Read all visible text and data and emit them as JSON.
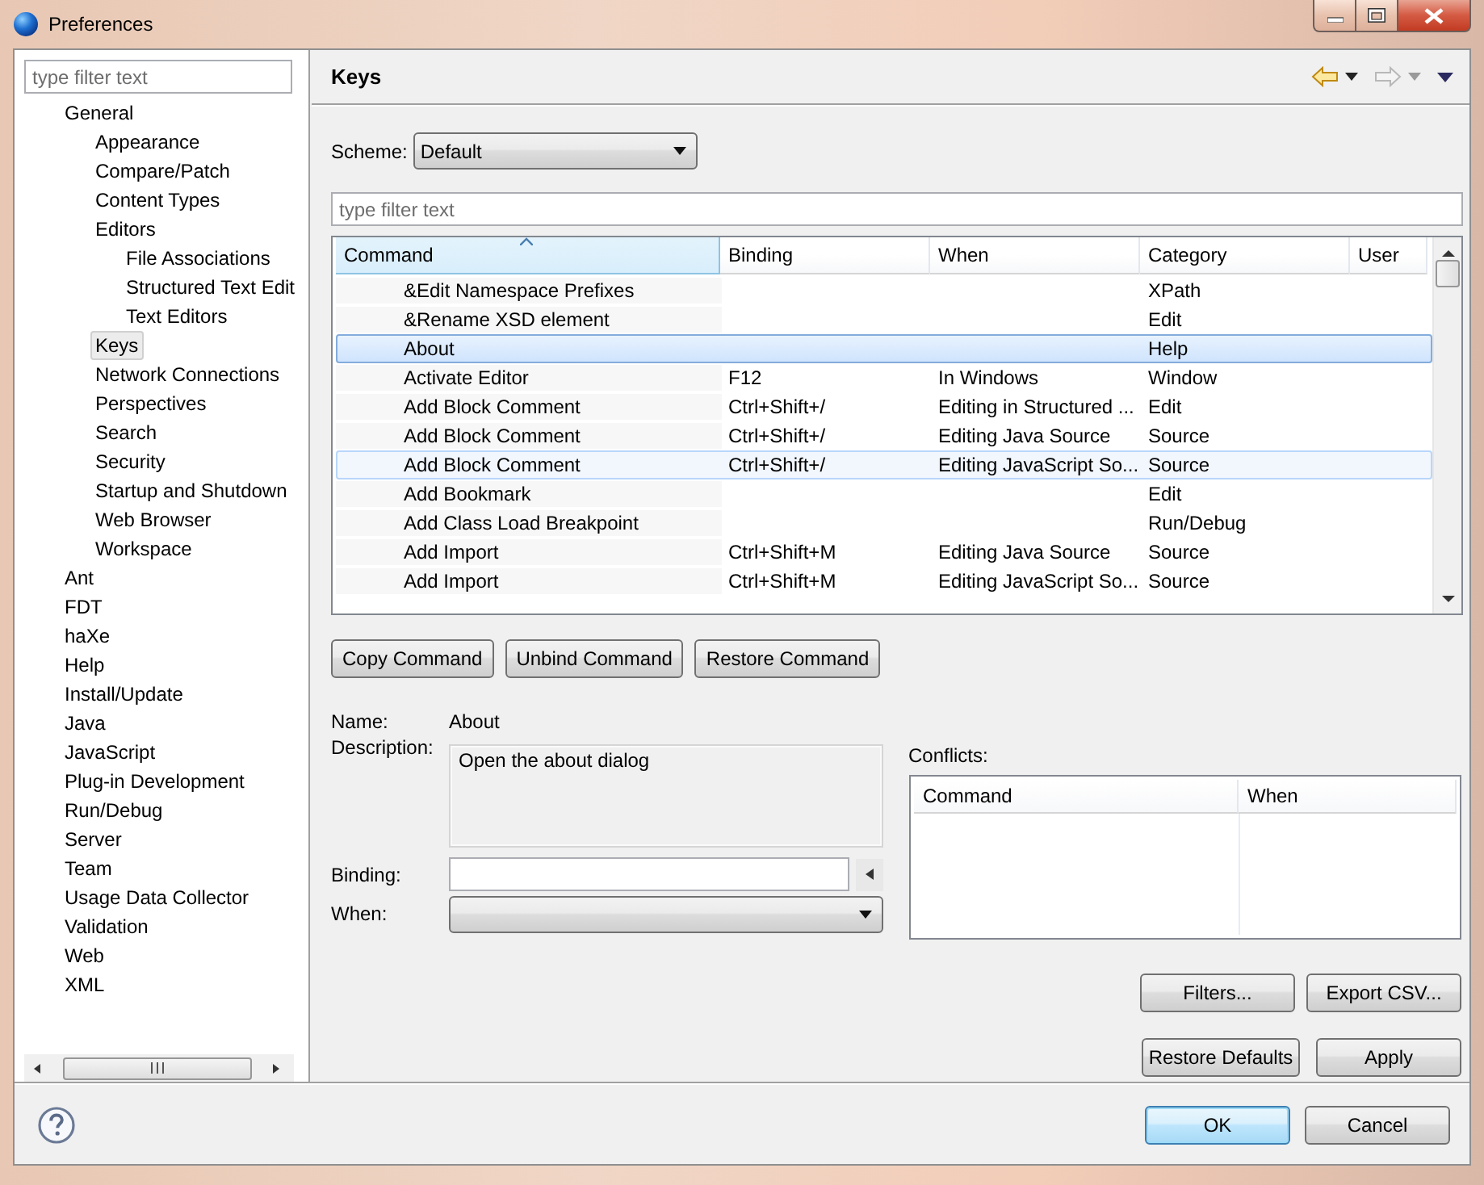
{
  "window": {
    "title": "Preferences"
  },
  "sidebar": {
    "filter": {
      "placeholder": "type filter text"
    },
    "tree": [
      {
        "label": "General",
        "selected": false,
        "children": [
          {
            "label": "Appearance",
            "selected": false
          },
          {
            "label": "Compare/Patch",
            "selected": false
          },
          {
            "label": "Content Types",
            "selected": false
          },
          {
            "label": "Editors",
            "selected": false,
            "children": [
              {
                "label": "File Associations",
                "selected": false
              },
              {
                "label": "Structured Text Edit",
                "selected": false
              },
              {
                "label": "Text Editors",
                "selected": false
              }
            ]
          },
          {
            "label": "Keys",
            "selected": true
          },
          {
            "label": "Network Connections",
            "selected": false
          },
          {
            "label": "Perspectives",
            "selected": false
          },
          {
            "label": "Search",
            "selected": false
          },
          {
            "label": "Security",
            "selected": false
          },
          {
            "label": "Startup and Shutdown",
            "selected": false
          },
          {
            "label": "Web Browser",
            "selected": false
          },
          {
            "label": "Workspace",
            "selected": false
          }
        ]
      },
      {
        "label": "Ant",
        "selected": false
      },
      {
        "label": "FDT",
        "selected": false
      },
      {
        "label": "haXe",
        "selected": false
      },
      {
        "label": "Help",
        "selected": false
      },
      {
        "label": "Install/Update",
        "selected": false
      },
      {
        "label": "Java",
        "selected": false
      },
      {
        "label": "JavaScript",
        "selected": false
      },
      {
        "label": "Plug-in Development",
        "selected": false
      },
      {
        "label": "Run/Debug",
        "selected": false
      },
      {
        "label": "Server",
        "selected": false
      },
      {
        "label": "Team",
        "selected": false
      },
      {
        "label": "Usage Data Collector",
        "selected": false
      },
      {
        "label": "Validation",
        "selected": false
      },
      {
        "label": "Web",
        "selected": false
      },
      {
        "label": "XML",
        "selected": false
      }
    ]
  },
  "page": {
    "title": "Keys",
    "scheme": {
      "label": "Scheme:",
      "value": "Default"
    },
    "filter": {
      "placeholder": "type filter text"
    },
    "table": {
      "columns": [
        {
          "label": "Command",
          "sorted": true
        },
        {
          "label": "Binding",
          "sorted": false
        },
        {
          "label": "When",
          "sorted": false
        },
        {
          "label": "Category",
          "sorted": false
        },
        {
          "label": "User",
          "sorted": false
        }
      ],
      "rows": [
        {
          "command": "&Edit Namespace Prefixes",
          "category": "XPath",
          "selected": false,
          "hovered": false
        },
        {
          "command": "&Rename XSD element",
          "category": "Edit",
          "selected": false,
          "hovered": false
        },
        {
          "command": "About",
          "category": "Help",
          "selected": true,
          "hovered": false
        },
        {
          "command": "Activate Editor",
          "binding": "F12",
          "when": "In Windows",
          "category": "Window",
          "selected": false,
          "hovered": false
        },
        {
          "command": "Add Block Comment",
          "binding": "Ctrl+Shift+/",
          "when": "Editing in Structured ...",
          "category": "Edit",
          "selected": false,
          "hovered": false
        },
        {
          "command": "Add Block Comment",
          "binding": "Ctrl+Shift+/",
          "when": "Editing Java Source",
          "category": "Source",
          "selected": false,
          "hovered": false
        },
        {
          "command": "Add Block Comment",
          "binding": "Ctrl+Shift+/",
          "when": "Editing JavaScript So...",
          "category": "Source",
          "selected": false,
          "hovered": true
        },
        {
          "command": "Add Bookmark",
          "category": "Edit",
          "selected": false,
          "hovered": false
        },
        {
          "command": "Add Class Load Breakpoint",
          "category": "Run/Debug",
          "selected": false,
          "hovered": false
        },
        {
          "command": "Add Import",
          "binding": "Ctrl+Shift+M",
          "when": "Editing Java Source",
          "category": "Source",
          "selected": false,
          "hovered": false
        },
        {
          "command": "Add Import",
          "binding": "Ctrl+Shift+M",
          "when": "Editing JavaScript So...",
          "category": "Source",
          "selected": false,
          "hovered": false
        }
      ]
    },
    "buttons": [
      "Copy Command",
      "Unbind Command",
      "Restore Command"
    ],
    "details": {
      "name_label": "Name:",
      "name": "About",
      "description_label": "Description:",
      "description": "Open the about dialog",
      "binding_label": "Binding:",
      "when_label": "When:"
    },
    "conflicts": {
      "label": "Conflicts:",
      "columns": [
        "Command",
        "When"
      ]
    },
    "table_buttons": [
      "Filters...",
      "Export CSV..."
    ],
    "page_buttons": [
      "Restore Defaults",
      "Apply"
    ]
  },
  "dialog_buttons": [
    {
      "label": "OK",
      "default": true
    },
    {
      "label": "Cancel",
      "default": false
    }
  ]
}
